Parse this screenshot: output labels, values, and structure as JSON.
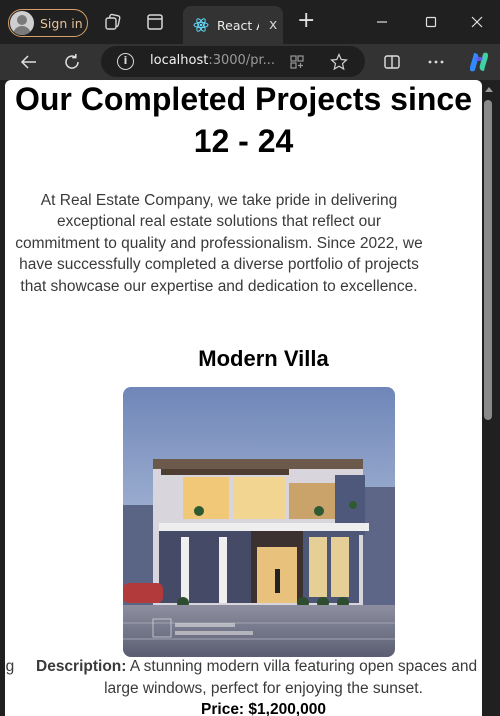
{
  "browser": {
    "signin_label": "Sign in",
    "active_tab_title": "React A",
    "tab_close": "x",
    "new_tab": "+",
    "url_host": "localhost",
    "url_path": ":3000/pr...",
    "accent": "#d9a06a"
  },
  "page": {
    "title": "Our Completed Projects since 12 - 24",
    "intro": "At Real Estate Company, we take pride in delivering exceptional real estate solutions that reflect our commitment to quality and professionalism. Since 2022, we have successfully completed a diverse portfolio of projects that showcase our expertise and dedication to excellence.",
    "project": {
      "name": "Modern Villa",
      "desc_fragment": "ng",
      "desc_label": "Description:",
      "desc_line1": " A stunning modern villa featuring open spaces and",
      "desc_line2": "large windows, perfect for enjoying the sunset.",
      "price": "Price: $1,200,000",
      "image_watermark": "villa render"
    }
  }
}
